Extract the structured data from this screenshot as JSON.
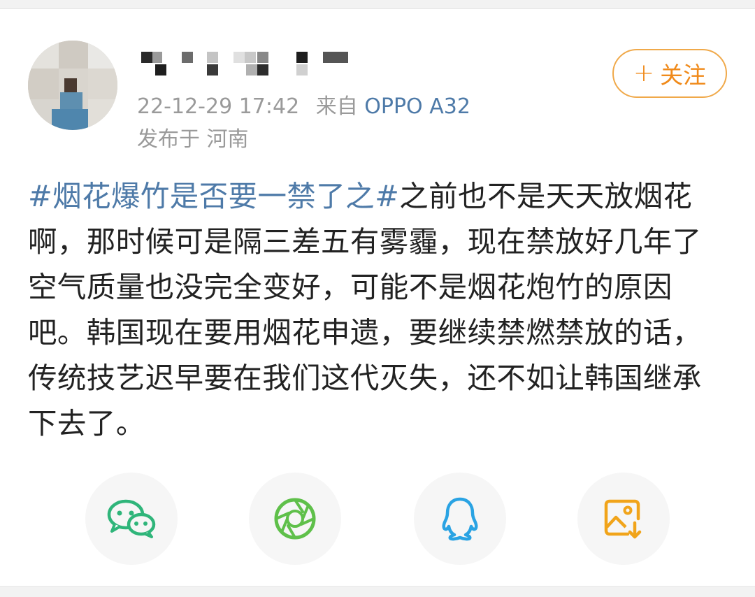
{
  "header": {
    "timestamp": "22-12-29 17:42",
    "source_prefix": "来自",
    "device": "OPPO A32",
    "location": "发布于 河南",
    "follow_plus": "+",
    "follow_label": "关注"
  },
  "post": {
    "hashtag": "#烟花爆竹是否要一禁了之#",
    "text": "之前也不是天天放烟花啊，那时候可是隔三差五有雾霾，现在禁放好几年了空气质量也没完全变好，可能不是烟花炮竹的原因吧。韩国现在要用烟花申遗，要继续禁燃禁放的话，传统技艺迟早要在我们这代灭失，还不如让韩国继承下去了。"
  },
  "share": {
    "items": [
      {
        "icon": "wechat-icon",
        "color": "#2fb57a"
      },
      {
        "icon": "moments-icon",
        "color": "#5fc04a"
      },
      {
        "icon": "qq-icon",
        "color": "#2aa3e3"
      },
      {
        "icon": "save-image-icon",
        "color": "#f1a41a"
      }
    ]
  },
  "colors": {
    "link_blue": "#4e7aa8",
    "follow_orange": "#f08a1a",
    "meta_gray": "#9a9a9a",
    "text": "#222222"
  }
}
